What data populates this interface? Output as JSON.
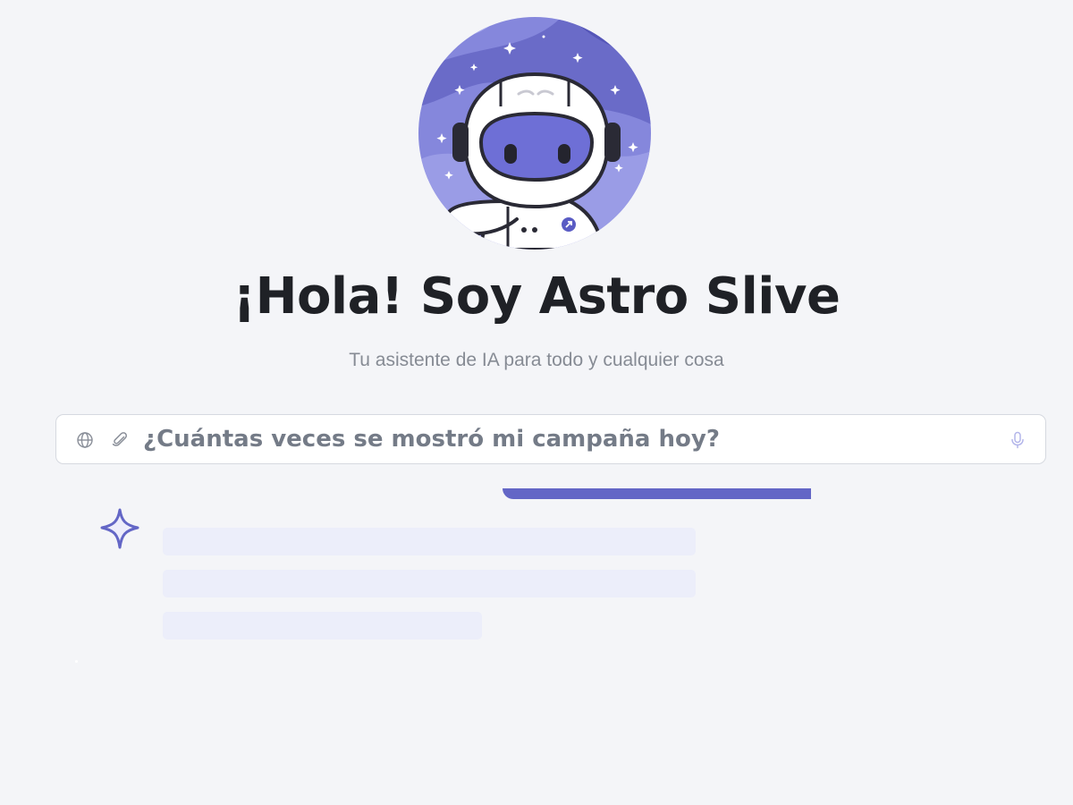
{
  "hero": {
    "avatar_icon": "astronaut-avatar-icon",
    "title": "¡Hola! Soy Astro Slive",
    "subtitle": "Tu asistente de IA para todo y cualquier cosa"
  },
  "composer": {
    "web_search_icon": "globe-icon",
    "attach_icon": "paperclip-icon",
    "query": "¿Cuántas veces se mostró mi campaña hoy?",
    "voice_icon": "microphone-icon"
  },
  "response": {
    "status_icon": "sparkle-icon",
    "skeleton_lines": 3
  },
  "colors": {
    "accent": "#6366c6",
    "skeleton": "#eceefa",
    "background": "#f4f5f8",
    "title_text": "#1f2126",
    "muted_text": "#868b94"
  }
}
